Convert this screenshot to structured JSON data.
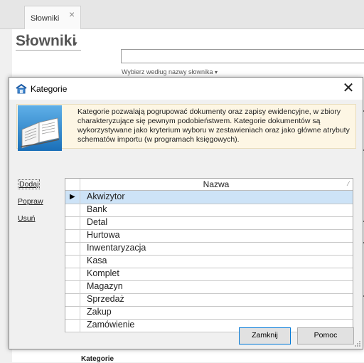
{
  "background": {
    "tab_label": "Słowniki",
    "tab_close": "×",
    "title": "Słowniki",
    "title_caret": "▾",
    "hint": "Wybierz według nazwy słownika",
    "hint_caret": "▾",
    "bottom_label": "Kategorie"
  },
  "dialog": {
    "title": "Kategorie",
    "close_symbol": "✕",
    "info_text": "Kategorie pozwalają pogrupować dokumenty oraz zapisy ewidencyjne, w zbiory charakteryzujące się pewnym podobieństwem. Kategorie dokumentów są wykorzystywane jako kryterium wyboru w zestawieniach oraz jako główne atrybuty schematów importu (w programach księgowych).",
    "actions": {
      "add": "Dodaj",
      "edit": "Popraw",
      "delete": "Usuń"
    },
    "grid": {
      "column_header": "Nazwa",
      "sort_glyph": "⁄",
      "selected_indicator": "▶",
      "rows": [
        "Akwizytor",
        "Bank",
        "Detal",
        "Hurtowa",
        "Inwentaryzacja",
        "Kasa",
        "Komplet",
        "Magazyn",
        "Sprzedaż",
        "Zakup",
        "Zamówienie"
      ],
      "selected_index": 0
    },
    "buttons": {
      "close": "Zamknij",
      "help": "Pomoc"
    }
  },
  "colors": {
    "selection": "#cde3f7",
    "info_background": "#fdf6e4",
    "default_button_border": "#0078d7"
  }
}
